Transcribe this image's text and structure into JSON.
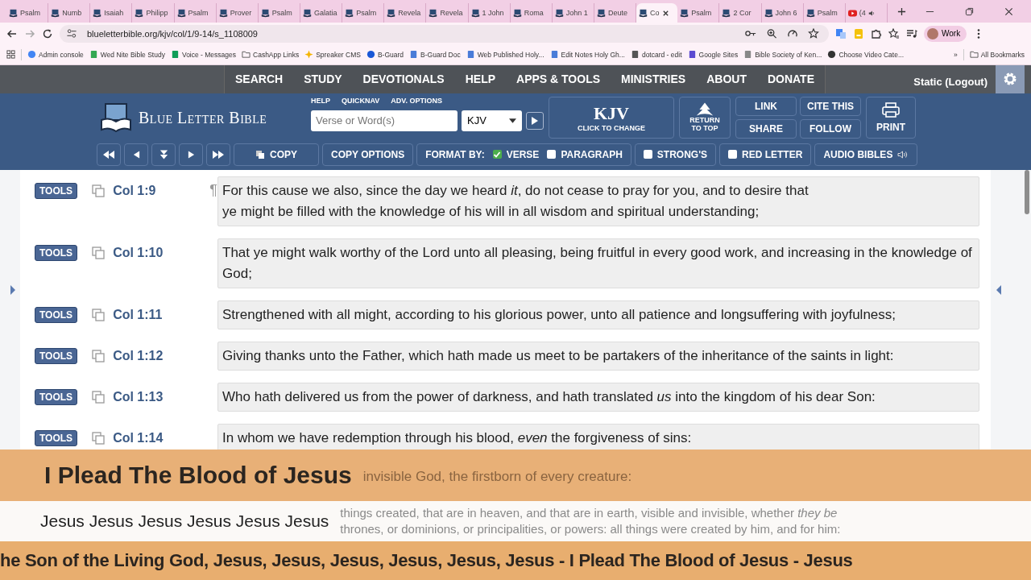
{
  "browser": {
    "tabs": [
      {
        "label": "Psalm",
        "selected": false,
        "kind": "site"
      },
      {
        "label": "Numb",
        "selected": false,
        "kind": "site"
      },
      {
        "label": "Isaiah",
        "selected": false,
        "kind": "site"
      },
      {
        "label": "Philipp",
        "selected": false,
        "kind": "site"
      },
      {
        "label": "Psalm",
        "selected": false,
        "kind": "site"
      },
      {
        "label": "Prover",
        "selected": false,
        "kind": "site"
      },
      {
        "label": "Psalm",
        "selected": false,
        "kind": "site"
      },
      {
        "label": "Galatia",
        "selected": false,
        "kind": "site"
      },
      {
        "label": "Psalm",
        "selected": false,
        "kind": "site"
      },
      {
        "label": "Revela",
        "selected": false,
        "kind": "site"
      },
      {
        "label": "Revela",
        "selected": false,
        "kind": "site"
      },
      {
        "label": "1 John",
        "selected": false,
        "kind": "site"
      },
      {
        "label": "Roma",
        "selected": false,
        "kind": "site"
      },
      {
        "label": "John 1",
        "selected": false,
        "kind": "site"
      },
      {
        "label": "Deute",
        "selected": false,
        "kind": "site"
      },
      {
        "label": "Co",
        "selected": true,
        "kind": "site"
      },
      {
        "label": "Psalm",
        "selected": false,
        "kind": "site"
      },
      {
        "label": "2 Cor",
        "selected": false,
        "kind": "site"
      },
      {
        "label": "John 6",
        "selected": false,
        "kind": "site"
      },
      {
        "label": "Psalm",
        "selected": false,
        "kind": "site"
      },
      {
        "label": "(4",
        "selected": false,
        "kind": "video"
      }
    ],
    "url": "blueletterbible.org/kjv/col/1/9-14/s_1108009",
    "profile": "Work",
    "bookmarks": [
      {
        "label": "Admin console",
        "kind": "google"
      },
      {
        "label": "Wed Nite Bible Study",
        "kind": "video"
      },
      {
        "label": "Voice - Messages",
        "kind": "phone"
      },
      {
        "label": "CashApp Links",
        "kind": "folder"
      },
      {
        "label": "Spreaker CMS",
        "kind": "star"
      },
      {
        "label": "B-Guard",
        "kind": "z"
      },
      {
        "label": "B-Guard Doc",
        "kind": "doc"
      },
      {
        "label": "Web Published Holy...",
        "kind": "doc"
      },
      {
        "label": "Edit Notes Holy Gh...",
        "kind": "doc"
      },
      {
        "label": "dotcard - edit",
        "kind": "dot"
      },
      {
        "label": "Google Sites",
        "kind": "sites"
      },
      {
        "label": "Bible Society of Ken...",
        "kind": "book"
      },
      {
        "label": "Choose Video Cate...",
        "kind": "target"
      }
    ],
    "more": "»",
    "all_bookmarks": "All Bookmarks"
  },
  "site": {
    "nav": [
      "SEARCH",
      "STUDY",
      "DEVOTIONALS",
      "HELP",
      "APPS & TOOLS",
      "MINISTRIES",
      "ABOUT",
      "DONATE"
    ],
    "user": "Static (Logout)",
    "logo": "Blue Letter Bible",
    "search_links": [
      "HELP",
      "QUICKNAV",
      "ADV. OPTIONS"
    ],
    "search": {
      "placeholder": "Verse or Word(s)"
    },
    "version": "KJV",
    "version_box": {
      "title": "KJV",
      "subtitle": "CLICK TO CHANGE"
    },
    "return_top": "RETURN TO TOP",
    "actions": [
      "LINK",
      "CITE THIS",
      "SHARE",
      "FOLLOW"
    ],
    "print": "PRINT",
    "copy": "COPY",
    "copy_options": "COPY OPTIONS",
    "format_label": "FORMAT BY:",
    "format_options": [
      {
        "label": "VERSE",
        "checked": true
      },
      {
        "label": "PARAGRAPH",
        "checked": false
      }
    ],
    "toggles": [
      {
        "label": "STRONG'S",
        "checked": false
      },
      {
        "label": "RED LETTER",
        "checked": false
      }
    ],
    "audio": "AUDIO BIBLES"
  },
  "verses": [
    {
      "tools": "TOOLS",
      "ref": "Col 1:9",
      "mark": "¶",
      "text": "For this cause we also, since the day we heard *it*, do not cease to pray for you, and to desire that\nye might be filled with the knowledge of his will in all wisdom and spiritual understanding;"
    },
    {
      "tools": "TOOLS",
      "ref": "Col 1:10",
      "text": "That ye might walk worthy of the Lord unto all pleasing, being fruitful in every good work, and increasing in the knowledge of God;"
    },
    {
      "tools": "TOOLS",
      "ref": "Col 1:11",
      "text": "Strengthened with all might, according to his glorious power, unto all patience and longsuffering with joyfulness;"
    },
    {
      "tools": "TOOLS",
      "ref": "Col 1:12",
      "text": "Giving thanks unto the Father, which hath made us meet to be partakers of the inheritance of the saints in light:"
    },
    {
      "tools": "TOOLS",
      "ref": "Col 1:13",
      "text": "Who hath delivered us from the power of darkness, and hath translated *us* into the kingdom of his dear Son:"
    },
    {
      "tools": "TOOLS",
      "ref": "Col 1:14",
      "text": "In whom we have redemption through his blood, *even* the forgiveness of sins:"
    }
  ],
  "overlay": {
    "title": "I Plead The Blood of Jesus",
    "title_behind": "invisible God, the firstborn of every creature:",
    "subtitle": "Jesus Jesus Jesus Jesus Jesus Jesus",
    "subtitle_behind": [
      "things created, that are in heaven, and that are in earth, visible and invisible, whether *they be*",
      "thrones, or dominions, or principalities, or powers: all things were created by him, and for him:"
    ],
    "ticker": "he Son of the Living God, Jesus, Jesus, Jesus, Jesus, Jesus, Jesus - I Plead The Blood of Jesus - Jesus"
  }
}
